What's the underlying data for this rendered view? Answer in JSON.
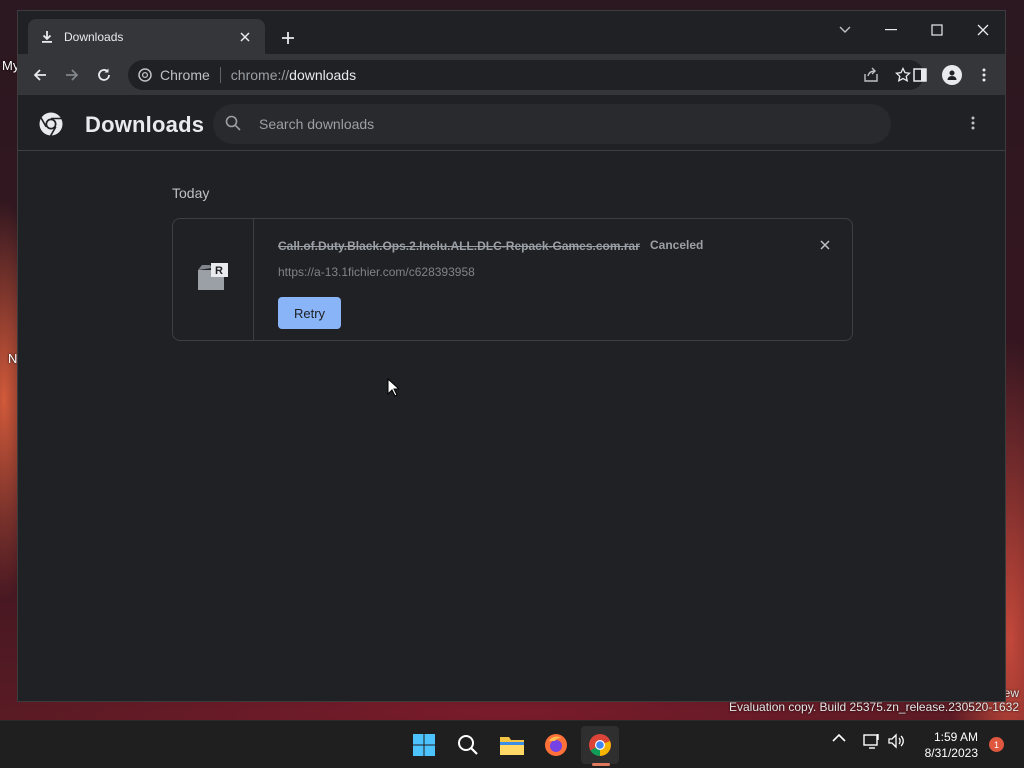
{
  "desktop": {
    "label_my": "My",
    "label_n": "N",
    "eval_new": "ew",
    "evaluation_text": "Evaluation copy. Build 25375.zn_release.230520-1632"
  },
  "browser": {
    "tab": {
      "title": "Downloads",
      "icon": "download-icon"
    },
    "omnibox": {
      "site_label": "Chrome",
      "url_scheme": "chrome://",
      "url_path": "downloads"
    },
    "accent_color": "#8ab4f8"
  },
  "page": {
    "title": "Downloads",
    "search_placeholder": "Search downloads",
    "section_date": "Today",
    "downloads": [
      {
        "file_name": "Call.of.Duty.Black.Ops.2.Inclu.ALL.DLC-Repack-Games.com.rar",
        "status": "Canceled",
        "url": "https://a-13.1fichier.com/c628393958",
        "action_label": "Retry",
        "file_icon": "rar-archive-icon"
      }
    ]
  },
  "taskbar": {
    "apps": [
      "start-icon",
      "search-icon",
      "file-explorer-icon",
      "firefox-icon",
      "chrome-icon"
    ],
    "active_app": "chrome-icon",
    "time": "1:59 AM",
    "date": "8/31/2023",
    "notification_count": "1"
  }
}
